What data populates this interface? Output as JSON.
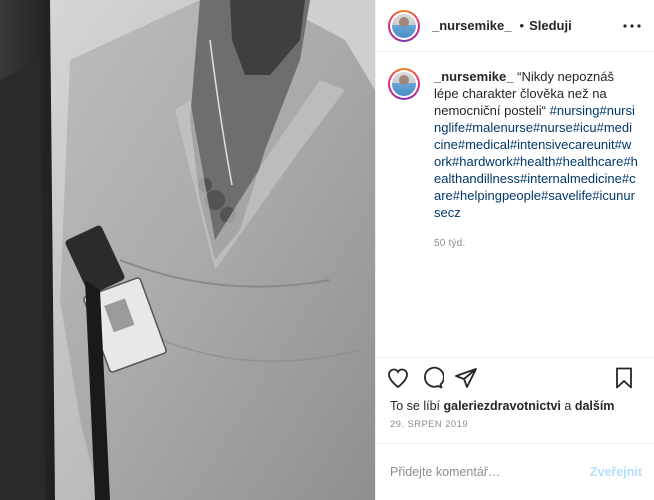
{
  "post": {
    "photo_alt": "black-and-white photo of a person in medical scrubs",
    "author": {
      "username": "_nursemike_",
      "avatar_icon": "profile-avatar"
    },
    "header": {
      "dot": "•",
      "follow_label": "Sleduji",
      "more_icon": "more-horizontal-icon"
    },
    "caption": {
      "username": "_nursemike_",
      "text": " “Nikdy nepoznáš lépe charakter člověka než na nemocniční posteli“ ",
      "hashtags": "#nursing#nursinglife#malenurse#nurse#icu#medicine#medical#intensivecareunit#work#hardwork#health#healthcare#healthandillness#internalmedicine#care#helpingpeople#savelife#icunursecz",
      "age": "50 týd."
    },
    "actions": {
      "like_icon": "heart-icon",
      "comment_icon": "comment-icon",
      "share_icon": "share-icon",
      "save_icon": "bookmark-icon"
    },
    "likes": {
      "prefix": "To se líbí ",
      "user": "galeriezdravotnictvi",
      "conj": " a ",
      "others": "dalším"
    },
    "date": "29. SRPEN 2019",
    "comment_box": {
      "placeholder": "Přidejte komentář…",
      "post_label": "Zveřejnit"
    },
    "colors": {
      "link": "#00376b",
      "muted": "#8e8e8e",
      "post_disabled": "#b2dffc"
    }
  }
}
